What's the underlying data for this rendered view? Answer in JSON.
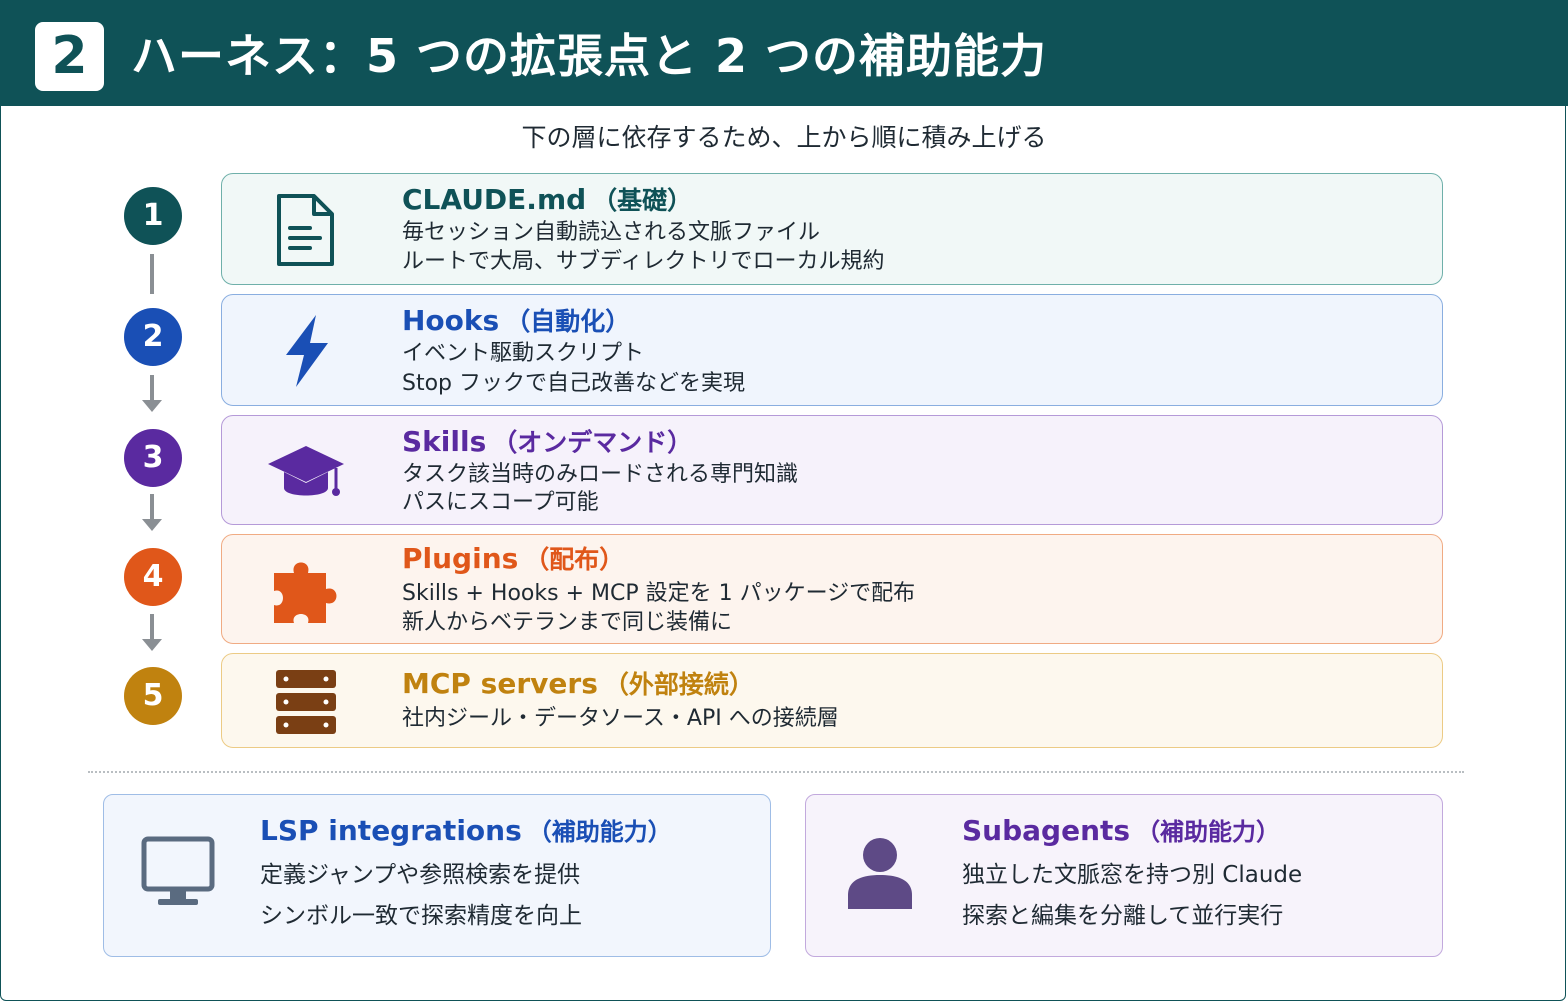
{
  "header": {
    "badge": "2",
    "title": "ハーネス：5 つの拡張点と 2 つの補助能力"
  },
  "subtitle": "下の層に依存するため、上から順に積み上げる",
  "layers": [
    {
      "number": "1",
      "title": "CLAUDE.md",
      "subtitle": "（基礎）",
      "lines": [
        "毎セッション自動読込される文脈ファイル",
        "ルートで大局、サブディレクトリでローカル規約"
      ],
      "icon": "document-icon",
      "color": "#0f5257",
      "bg": "#f1f8f7",
      "border": "#6fb0aa"
    },
    {
      "number": "2",
      "title": "Hooks",
      "subtitle": "（自動化）",
      "lines": [
        "イベント駆動スクリプト",
        "Stop フックで自己改善などを実現"
      ],
      "icon": "lightning-icon",
      "color": "#1a4fb5",
      "bg": "#f0f5fd",
      "border": "#8aaee0"
    },
    {
      "number": "3",
      "title": "Skills",
      "subtitle": "（オンデマンド）",
      "lines": [
        "タスク該当時のみロードされる専門知識",
        "パスにスコープ可能"
      ],
      "icon": "graduation-cap-icon",
      "color": "#5a2aa0",
      "bg": "#f6f2fb",
      "border": "#b59ad8"
    },
    {
      "number": "4",
      "title": "Plugins",
      "subtitle": "（配布）",
      "lines": [
        "Skills + Hooks + MCP 設定を 1 パッケージで配布",
        "新人からベテランまで同じ装備に"
      ],
      "icon": "puzzle-piece-icon",
      "color": "#e0571a",
      "bg": "#fdf4ee",
      "border": "#f0ab83"
    },
    {
      "number": "5",
      "title": "MCP servers",
      "subtitle": "（外部接続）",
      "lines": [
        "社内ジール・データソース・API への接続層"
      ],
      "icon": "server-icon",
      "color": "#c0820f",
      "bg": "#fdf8ee",
      "border": "#eccb85"
    }
  ],
  "auxiliary": [
    {
      "title": "LSP integrations",
      "subtitle": "（補助能力）",
      "lines": [
        "定義ジャンプや参照検索を提供",
        "シンボル一致で探索精度を向上"
      ],
      "icon": "monitor-icon",
      "color": "#1a4fb5",
      "bg": "#f2f6fd",
      "border": "#9fbde6"
    },
    {
      "title": "Subagents",
      "subtitle": "（補助能力）",
      "lines": [
        "独立した文脈窓を持つ別 Claude",
        "探索と編集を分離して並行実行"
      ],
      "icon": "person-icon",
      "color": "#5a2aa0",
      "bg": "#f7f3fb",
      "border": "#c2a9dd"
    }
  ]
}
